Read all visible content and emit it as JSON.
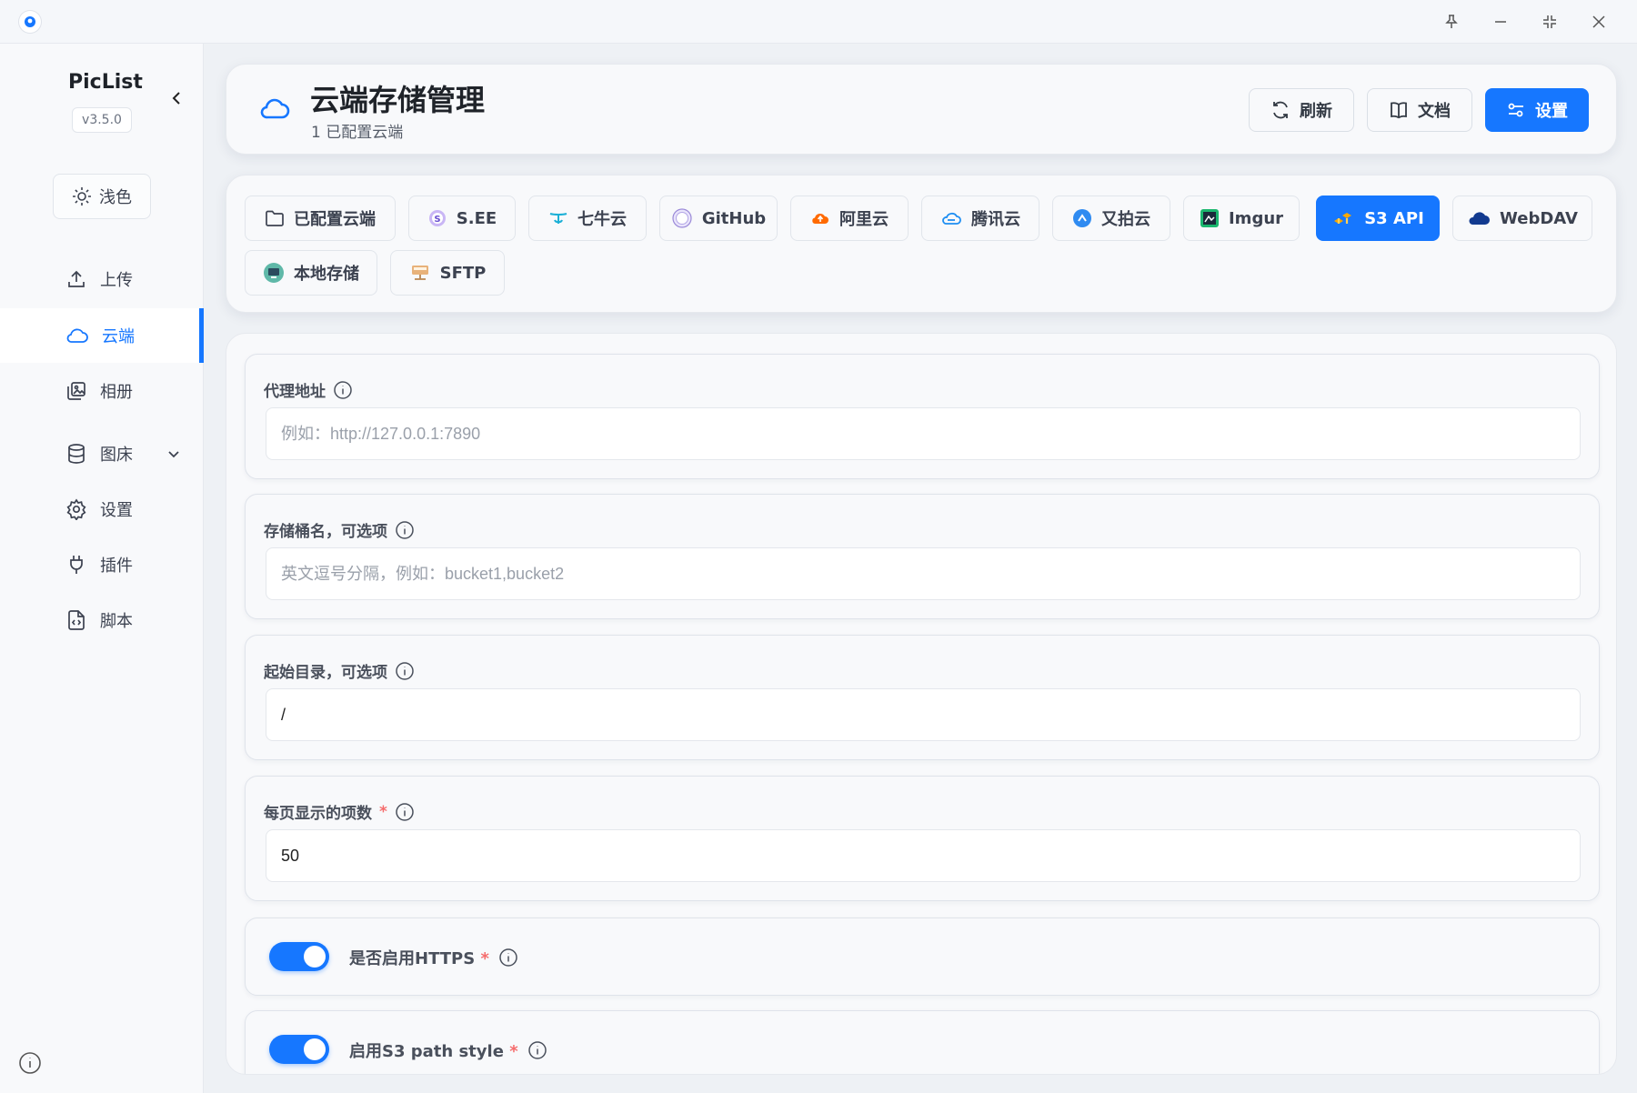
{
  "app": {
    "name": "PicList",
    "version": "v3.5.0"
  },
  "sidebar": {
    "theme_label": "浅色",
    "items": [
      {
        "label": "上传",
        "icon": "upload-icon"
      },
      {
        "label": "云端",
        "icon": "cloud-icon",
        "active": true
      },
      {
        "label": "相册",
        "icon": "gallery-icon"
      },
      {
        "label": "图床",
        "icon": "database-icon",
        "expandable": true
      },
      {
        "label": "设置",
        "icon": "gear-icon"
      },
      {
        "label": "插件",
        "icon": "plug-icon"
      },
      {
        "label": "脚本",
        "icon": "script-file-icon"
      }
    ]
  },
  "header": {
    "title": "云端存储管理",
    "subtitle": "1 已配置云端",
    "refresh_label": "刷新",
    "docs_label": "文档",
    "settings_label": "设置"
  },
  "tabs": [
    {
      "label": "已配置云端",
      "icon": "folder-icon"
    },
    {
      "label": "S.EE",
      "icon": "see-logo-icon"
    },
    {
      "label": "七牛云",
      "icon": "qiniu-logo-icon"
    },
    {
      "label": "GitHub",
      "icon": "github-logo-icon"
    },
    {
      "label": "阿里云",
      "icon": "aliyun-logo-icon"
    },
    {
      "label": "腾讯云",
      "icon": "tencent-cloud-logo-icon"
    },
    {
      "label": "又拍云",
      "icon": "upyun-logo-icon"
    },
    {
      "label": "Imgur",
      "icon": "imgur-logo-icon"
    },
    {
      "label": "S3 API",
      "icon": "s3-logo-icon",
      "active": true
    },
    {
      "label": "WebDAV",
      "icon": "webdav-cloud-icon"
    },
    {
      "label": "本地存储",
      "icon": "local-storage-icon"
    },
    {
      "label": "SFTP",
      "icon": "sftp-server-icon"
    }
  ],
  "form": {
    "proxy": {
      "label": "代理地址",
      "placeholder": "例如：http://127.0.0.1:7890",
      "value": ""
    },
    "bucket": {
      "label": "存储桶名，可选项",
      "placeholder": "英文逗号分隔，例如：bucket1,bucket2",
      "value": ""
    },
    "start_dir": {
      "label": "起始目录，可选项",
      "value": "/"
    },
    "page_size": {
      "label": "每页显示的项数",
      "required_mark": "*",
      "value": "50"
    },
    "https": {
      "label": "是否启用HTTPS",
      "required_mark": "*",
      "enabled": true
    },
    "path_style": {
      "label": "启用S3 path style",
      "required_mark": "*",
      "enabled": true
    }
  },
  "colors": {
    "accent": "#1677ff",
    "required": "#f56c6c"
  }
}
